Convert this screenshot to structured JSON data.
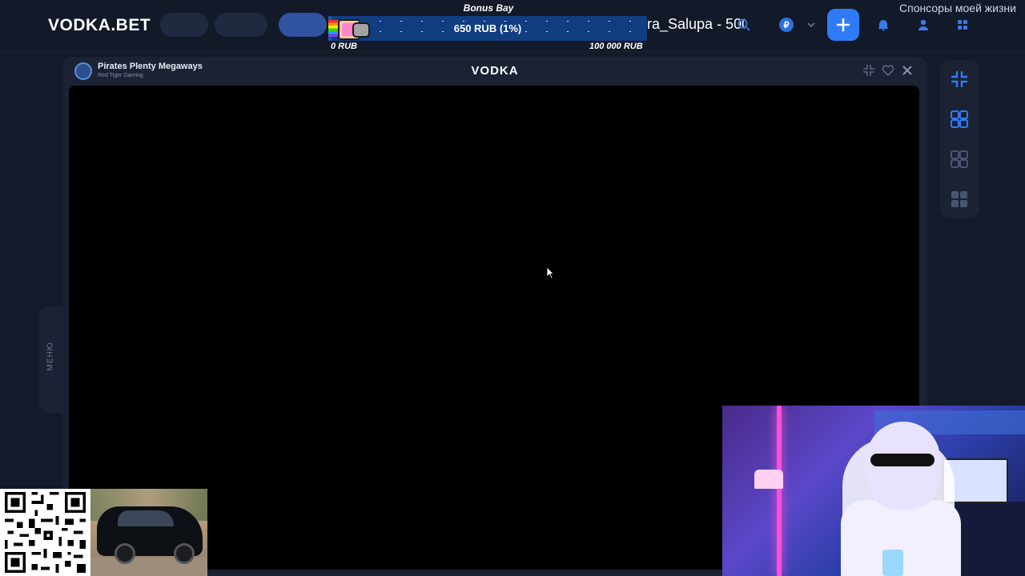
{
  "header": {
    "logo": "VODKA.BET",
    "bonus_title": "Bonus Bay",
    "bonus_value": "650 RUB (1%)",
    "bonus_progress_percent": 1,
    "bonus_min": "0 RUB",
    "bonus_max": "100 000 RUB",
    "ticker_text": "ra_Salupa - 500",
    "sponsor_text": "Спонсоры моей жизни",
    "currency_symbol": "₽",
    "icons": [
      "search-icon",
      "currency-icon",
      "chevron-down-icon",
      "plus-icon",
      "bell-icon",
      "user-icon",
      "grid-icon"
    ]
  },
  "game": {
    "title": "Pirates Plenty Megaways",
    "provider": "Red Tiger Gaming",
    "brand": "VODKA",
    "header_icons": [
      "minimize-icon",
      "heart-icon",
      "close-icon"
    ]
  },
  "side_menu": {
    "label": "МЕНЮ"
  },
  "right_rail": {
    "items": [
      "collapse-icon",
      "layout-single-icon",
      "layout-double-icon",
      "layout-quad-icon"
    ]
  },
  "colors": {
    "background": "#131a2a",
    "panel": "#1a2234",
    "accent": "#2f7bf5",
    "bonus_bar": "#103e80"
  }
}
